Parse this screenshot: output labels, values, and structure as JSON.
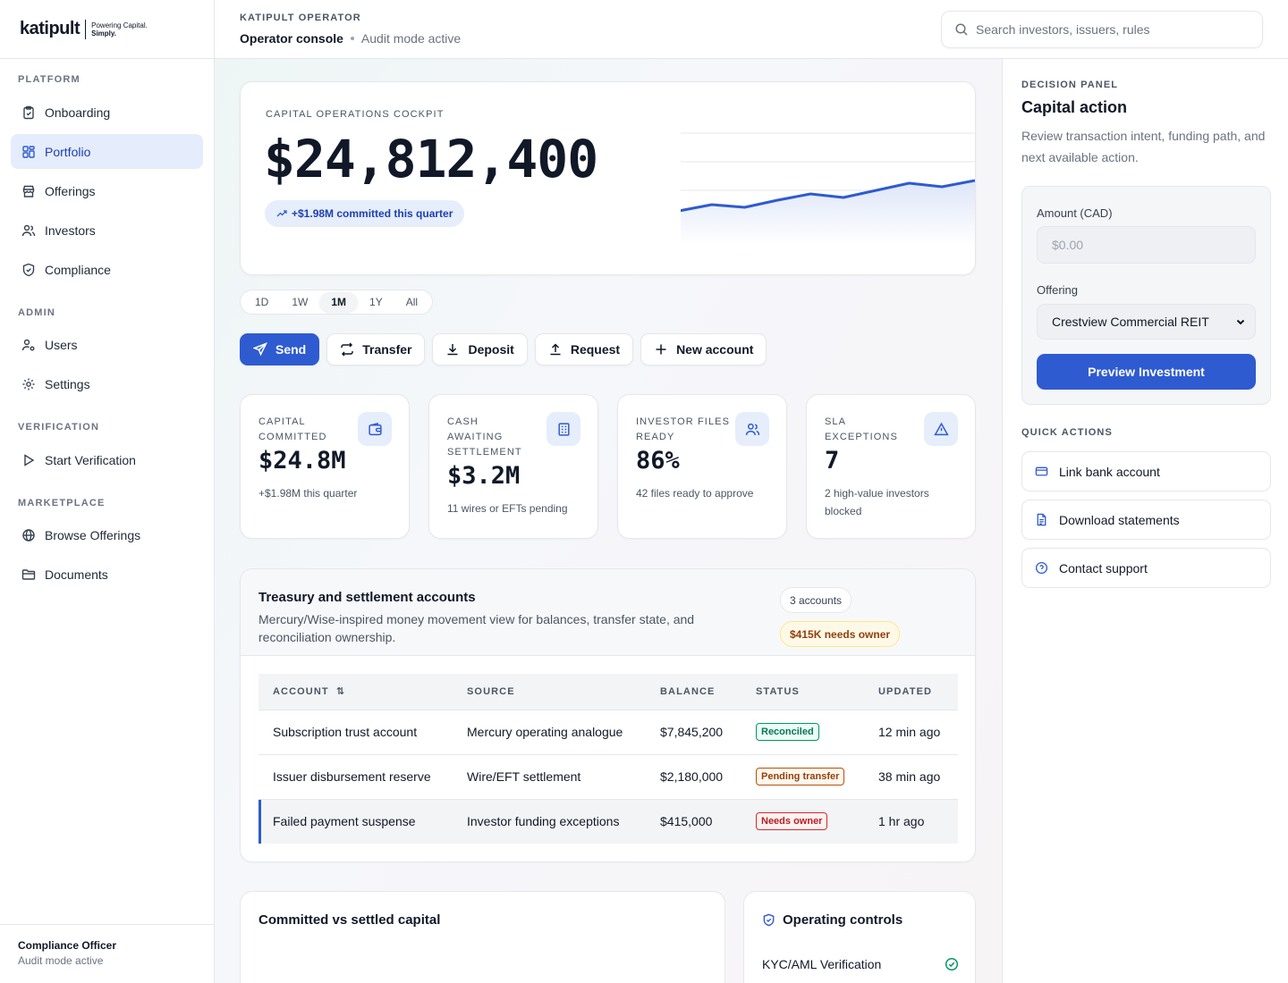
{
  "brand": {
    "logo_word": "katipult",
    "tagline_line1": "Powering Capital.",
    "tagline_line2": "Simply."
  },
  "sidebar": {
    "sections": [
      {
        "label": "PLATFORM"
      },
      {
        "label": "ADMIN"
      },
      {
        "label": "VERIFICATION"
      },
      {
        "label": "MARKETPLACE"
      }
    ],
    "items": [
      {
        "label": "Onboarding",
        "icon": "clipboard-icon"
      },
      {
        "label": "Portfolio",
        "icon": "grid-icon",
        "active": true
      },
      {
        "label": "Offerings",
        "icon": "store-icon"
      },
      {
        "label": "Investors",
        "icon": "users-icon"
      },
      {
        "label": "Compliance",
        "icon": "shield-icon"
      },
      {
        "label": "Users",
        "icon": "user-gear-icon"
      },
      {
        "label": "Settings",
        "icon": "gear-icon"
      },
      {
        "label": "Start Verification",
        "icon": "play-icon"
      },
      {
        "label": "Browse Offerings",
        "icon": "globe-icon"
      },
      {
        "label": "Documents",
        "icon": "folder-icon"
      }
    ],
    "footer": {
      "name": "Compliance Officer",
      "status": "Audit mode active"
    }
  },
  "header": {
    "eyebrow": "KATIPULT OPERATOR",
    "title": "Operator console",
    "subtitle": "Audit mode active",
    "search_placeholder": "Search investors, issuers, rules"
  },
  "hero": {
    "eyebrow": "CAPITAL OPERATIONS COCKPIT",
    "value": "$24,812,400",
    "change": "+$1.98M committed this quarter",
    "sparkline": [
      52,
      45,
      48,
      40,
      33,
      37,
      29,
      21,
      25,
      18
    ]
  },
  "ranges": [
    {
      "label": "1D"
    },
    {
      "label": "1W"
    },
    {
      "label": "1M",
      "active": true
    },
    {
      "label": "1Y"
    },
    {
      "label": "All"
    }
  ],
  "actions": [
    {
      "label": "Send",
      "icon": "send-icon",
      "primary": true
    },
    {
      "label": "Transfer",
      "icon": "transfer-icon"
    },
    {
      "label": "Deposit",
      "icon": "download-icon"
    },
    {
      "label": "Request",
      "icon": "upload-icon"
    },
    {
      "label": "New account",
      "icon": "plus-icon"
    }
  ],
  "kpis": [
    {
      "label": "CAPITAL COMMITTED",
      "value": "$24.8M",
      "sub": "+$1.98M this quarter",
      "icon": "wallet-icon"
    },
    {
      "label": "CASH AWAITING SETTLEMENT",
      "value": "$3.2M",
      "sub": "11 wires or EFTs pending",
      "icon": "bank-icon"
    },
    {
      "label": "INVESTOR FILES READY",
      "value": "86%",
      "sub": "42 files ready to approve",
      "icon": "users-icon"
    },
    {
      "label": "SLA EXCEPTIONS",
      "value": "7",
      "sub": "2 high-value investors blocked",
      "icon": "alert-icon"
    }
  ],
  "treasury": {
    "title": "Treasury and settlement accounts",
    "description": "Mercury/Wise-inspired money movement view for balances, transfer state, and reconciliation ownership.",
    "count_badge": "3 accounts",
    "warn_badge": "$415K needs owner",
    "columns": [
      "ACCOUNT",
      "SOURCE",
      "BALANCE",
      "STATUS",
      "UPDATED"
    ],
    "rows": [
      {
        "account": "Subscription trust account",
        "source": "Mercury operating analogue",
        "balance": "$7,845,200",
        "status": "Reconciled",
        "updated": "12 min ago"
      },
      {
        "account": "Issuer disbursement reserve",
        "source": "Wire/EFT settlement",
        "balance": "$2,180,000",
        "status": "Pending transfer",
        "updated": "38 min ago"
      },
      {
        "account": "Failed payment suspense",
        "source": "Investor funding exceptions",
        "balance": "$415,000",
        "status": "Needs owner",
        "updated": "1 hr ago"
      }
    ]
  },
  "committed_card": {
    "title": "Committed vs settled capital"
  },
  "controls_card": {
    "title": "Operating controls",
    "items": [
      {
        "label": "KYC/AML Verification"
      }
    ]
  },
  "panel": {
    "eyebrow": "DECISION PANEL",
    "title": "Capital action",
    "description": "Review transaction intent, funding path, and next available action.",
    "amount_label": "Amount (CAD)",
    "amount_placeholder": "$0.00",
    "offering_label": "Offering",
    "offering_value": "Crestview Commercial REIT",
    "preview_button": "Preview Investment",
    "quick_actions_label": "QUICK ACTIONS",
    "quick_actions": [
      {
        "label": "Link bank account",
        "icon": "credit-card-icon"
      },
      {
        "label": "Download statements",
        "icon": "document-icon"
      },
      {
        "label": "Contact support",
        "icon": "help-icon"
      }
    ]
  },
  "colors": {
    "accent": "#2f5bd0",
    "accent_soft": "#e6edfb",
    "success": "#059669",
    "warning": "#b45309",
    "danger": "#dc2626"
  }
}
